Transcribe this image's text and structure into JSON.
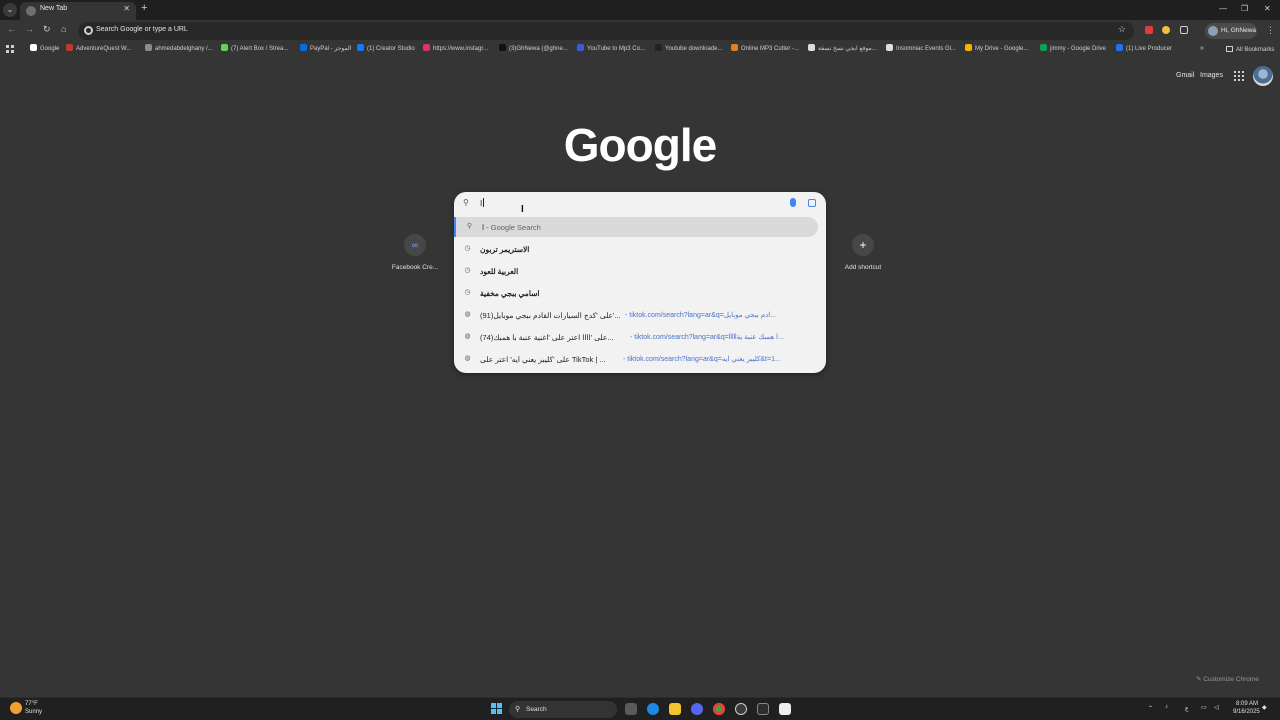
{
  "browser": {
    "tab_title": "New Tab",
    "omnibox_placeholder": "Search Google or type a URL",
    "profile_label": "Hi, GhNewa"
  },
  "bookmarks": [
    {
      "label": "Google",
      "color": "#ffffff"
    },
    {
      "label": "AdventureQuest W...",
      "color": "#c0392b"
    },
    {
      "label": "ahmedabdelghany /...",
      "color": "#8a8a8a"
    },
    {
      "label": "(7) Alert Box / Strea...",
      "color": "#5fd35f"
    },
    {
      "label": "PayPal - الموجز",
      "color": "#0070e0"
    },
    {
      "label": "(1) Creator Studio",
      "color": "#1877f2"
    },
    {
      "label": "https://www.instagr...",
      "color": "#e1306c"
    },
    {
      "label": "(3)GhNewa (@ghne...",
      "color": "#111111"
    },
    {
      "label": "YouTube to Mp3 Co...",
      "color": "#3b5bdb"
    },
    {
      "label": "Youtube downloade...",
      "color": "#222222"
    },
    {
      "label": "Online MP3 Cutter -...",
      "color": "#e67e22"
    },
    {
      "label": "موقع ابجي نسخ نسقة...",
      "color": "#dddddd"
    },
    {
      "label": "Insomniac Events Gl...",
      "color": "#dddddd"
    },
    {
      "label": "My Drive - Google...",
      "color": "#f4b400"
    },
    {
      "label": "jimmy - Google Drive",
      "color": "#0f9d58"
    },
    {
      "label": "(1) Live Producer",
      "color": "#1877f2"
    }
  ],
  "all_bookmarks_label": "All Bookmarks",
  "header_links": {
    "gmail": "Gmail",
    "images": "Images"
  },
  "logo_text": "Google",
  "shortcuts": [
    {
      "label": "Facebook Cre...",
      "icon": "∞"
    },
    {
      "label": "Add shortcut",
      "icon": "+"
    }
  ],
  "search": {
    "query": "ا",
    "suggestions": [
      {
        "type": "search",
        "text": "ا",
        "suffix": " - Google Search",
        "url": ""
      },
      {
        "type": "history",
        "text": "الاستريمر تربون",
        "suffix": "",
        "url": ""
      },
      {
        "type": "history",
        "text": "العربية للعود",
        "suffix": "",
        "url": ""
      },
      {
        "type": "history",
        "text": "اسامي ببجي مخفية",
        "suffix": "",
        "url": ""
      },
      {
        "type": "web",
        "text": "(91)على 'كدج السيارات القادم ببجي موبايل'...",
        "suffix": "",
        "url": "- tiktok.com/search?lang=ar&q=ادم ببجي موبايل..."
      },
      {
        "type": "web",
        "text": "(74)على 'اااا اعتر على 'اغنية عنبة با همبك...",
        "suffix": "",
        "url": "- tiktok.com/search?lang=ar&q=lllllا همبك عنبة ية..."
      },
      {
        "type": "web",
        "text": "على 'كليبز يعني ايه' اعتر على TikTok | ...",
        "suffix": "",
        "url": "- tiktok.com/search?lang=ar&q=كليبز يعني ايه&t=1..."
      }
    ]
  },
  "customize_label": "Customize Chrome",
  "taskbar": {
    "weather_temp": "77°F",
    "weather_cond": "Sunny",
    "search_label": "Search",
    "time": "8:09 AM",
    "date": "9/16/2025",
    "lang": "ع"
  },
  "colors": {
    "accent": "#4285f4",
    "background": "#353535",
    "dropdown": "#f2f2f2"
  }
}
